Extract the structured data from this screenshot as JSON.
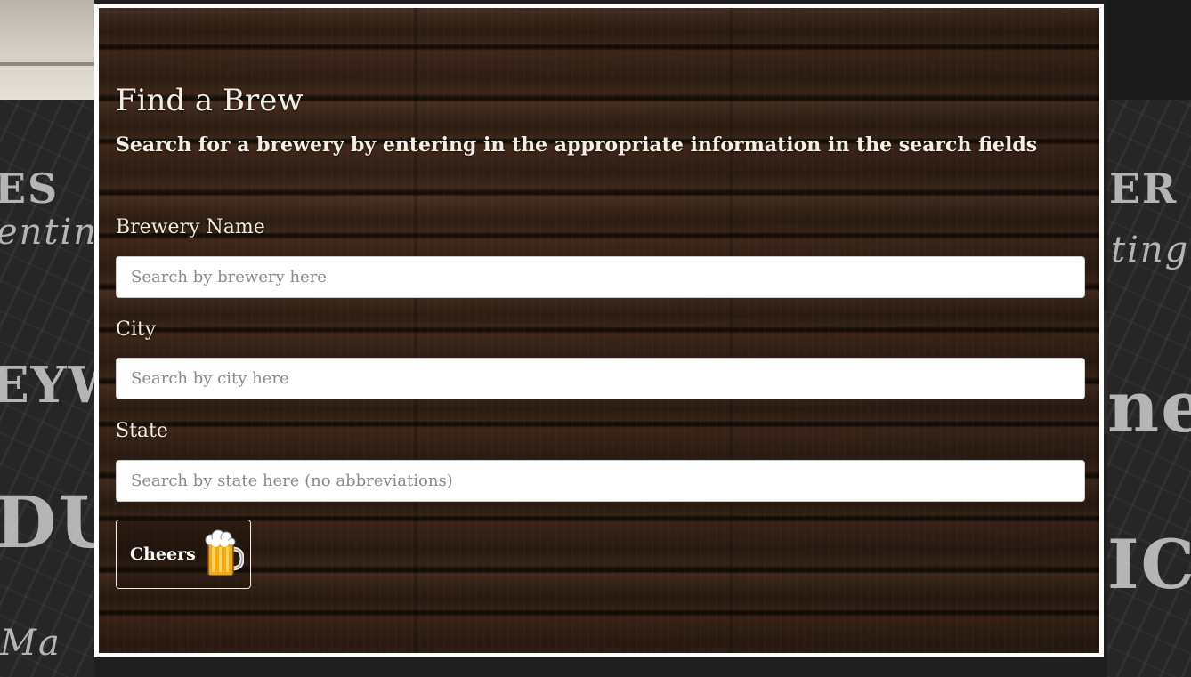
{
  "page": {
    "title": "Find a Brew",
    "subtitle": "Search for a brewery by entering in the appropriate information in the search fields"
  },
  "fields": [
    {
      "label": "Brewery Name",
      "placeholder": "Search by brewery here",
      "value": ""
    },
    {
      "label": "City",
      "placeholder": "Search by city here",
      "value": ""
    },
    {
      "label": "State",
      "placeholder": "Search by state here (no abbreviations)",
      "value": ""
    }
  ],
  "submit": {
    "label": "Cheers",
    "icon": "beer-mug-icon"
  },
  "colors": {
    "panel_border": "#ffffff",
    "wood": "#3a2418",
    "text": "#f4efe6"
  }
}
